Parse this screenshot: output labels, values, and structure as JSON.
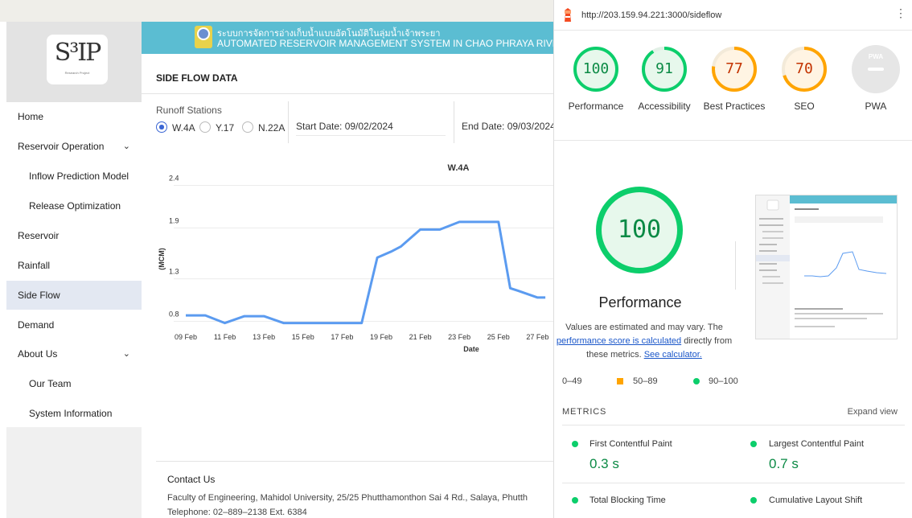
{
  "app": {
    "logo_text": "S³IP",
    "logo_sub": "Research Project",
    "banner": {
      "thai": "ระบบการจัดการอ่างเก็บน้ำแบบอัตโนมัติในลุ่มน้ำเจ้าพระยา",
      "english": "AUTOMATED RESERVOIR MANAGEMENT SYSTEM IN CHAO PHRAYA RIVER B"
    },
    "nav": [
      {
        "label": "Home"
      },
      {
        "label": "Reservoir Operation",
        "chevron": "chevron-down-icon"
      },
      {
        "label": "Inflow Prediction Model"
      },
      {
        "label": "Release Optimization"
      },
      {
        "label": "Reservoir"
      },
      {
        "label": "Rainfall"
      },
      {
        "label": "Side Flow",
        "active": true
      },
      {
        "label": "Demand"
      },
      {
        "label": "About Us",
        "chevron": "chevron-down-icon"
      },
      {
        "label": "Our Team"
      },
      {
        "label": "System Information"
      }
    ],
    "page_title": "SIDE FLOW DATA",
    "filters": {
      "runoff_label": "Runoff Stations",
      "stations": [
        "W.4A",
        "Y.17",
        "N.22A"
      ],
      "selected_station": "W.4A",
      "start_date": "Start Date: 09/02/2024",
      "end_date": "End Date: 09/03/2024"
    },
    "contact": {
      "title": "Contact Us",
      "address": "Faculty of Engineering, Mahidol University, 25/25 Phutthamonthon Sai 4 Rd., Salaya, Phutth",
      "phone": "Telephone: 02–889–2138 Ext. 6384"
    }
  },
  "chart_data": {
    "type": "line",
    "title": "W.4A",
    "xlabel": "Date",
    "ylabel": "(MCM)",
    "x_ticks": [
      "09 Feb",
      "11 Feb",
      "13 Feb",
      "15 Feb",
      "17 Feb",
      "19 Feb",
      "21 Feb",
      "23 Feb",
      "25 Feb",
      "27 Feb"
    ],
    "y_ticks": [
      0.8,
      1.3,
      1.9,
      2.4
    ],
    "ylim": [
      0.7,
      2.5
    ],
    "color": "#5b9bf0",
    "series": [
      {
        "values": [
          {
            "day": 9,
            "value": 0.87
          },
          {
            "day": 10,
            "value": 0.87
          },
          {
            "day": 11,
            "value": 0.78
          },
          {
            "day": 12,
            "value": 0.86
          },
          {
            "day": 13,
            "value": 0.86
          },
          {
            "day": 14,
            "value": 0.78
          },
          {
            "day": 15,
            "value": 0.78
          },
          {
            "day": 16,
            "value": 0.78
          },
          {
            "day": 17,
            "value": 0.78
          },
          {
            "day": 18,
            "value": 0.78
          },
          {
            "day": 18.8,
            "value": 1.55
          },
          {
            "day": 19.5,
            "value": 1.62
          },
          {
            "day": 20,
            "value": 1.68
          },
          {
            "day": 21,
            "value": 1.88
          },
          {
            "day": 22,
            "value": 1.88
          },
          {
            "day": 23,
            "value": 1.97
          },
          {
            "day": 24,
            "value": 1.97
          },
          {
            "day": 25,
            "value": 1.97
          },
          {
            "day": 25.6,
            "value": 1.19
          },
          {
            "day": 26,
            "value": 1.16
          },
          {
            "day": 27,
            "value": 1.08
          },
          {
            "day": 27.4,
            "value": 1.08
          }
        ]
      }
    ],
    "grid": true
  },
  "lighthouse": {
    "url": "http://203.159.94.221:3000/sideflow",
    "scores": [
      {
        "label": "Performance",
        "value": "100",
        "color": "#0cce6b",
        "bg": "#e7f8ec",
        "text": "#0b8a45"
      },
      {
        "label": "Accessibility",
        "value": "91",
        "color": "#0cce6b",
        "bg": "#e7f8ec",
        "text": "#0b8a45"
      },
      {
        "label": "Best Practices",
        "value": "77",
        "color": "#ffa400",
        "bg": "#fff4e3",
        "text": "#c33300"
      },
      {
        "label": "SEO",
        "value": "70",
        "color": "#ffa400",
        "bg": "#fff4e3",
        "text": "#c33300"
      }
    ],
    "pwa": {
      "label": "PWA",
      "badge": "PWA"
    },
    "main": {
      "value": "100",
      "label": "Performance",
      "disclaimer_1": "Values are estimated and may vary. The",
      "link_1": "performance score is calculated",
      "disclaimer_2": "directly from",
      "disclaimer_3": "these metrics.",
      "link_2": "See calculator."
    },
    "legend": {
      "low": "0–49",
      "mid": "50–89",
      "high": "90–100"
    },
    "metrics_header": "METRICS",
    "expand_view": "Expand view",
    "metrics": [
      {
        "name": "First Contentful Paint",
        "value": "0.3 s"
      },
      {
        "name": "Largest Contentful Paint",
        "value": "0.7 s"
      },
      {
        "name": "Total Blocking Time",
        "value": ""
      },
      {
        "name": "Cumulative Layout Shift",
        "value": ""
      }
    ]
  }
}
